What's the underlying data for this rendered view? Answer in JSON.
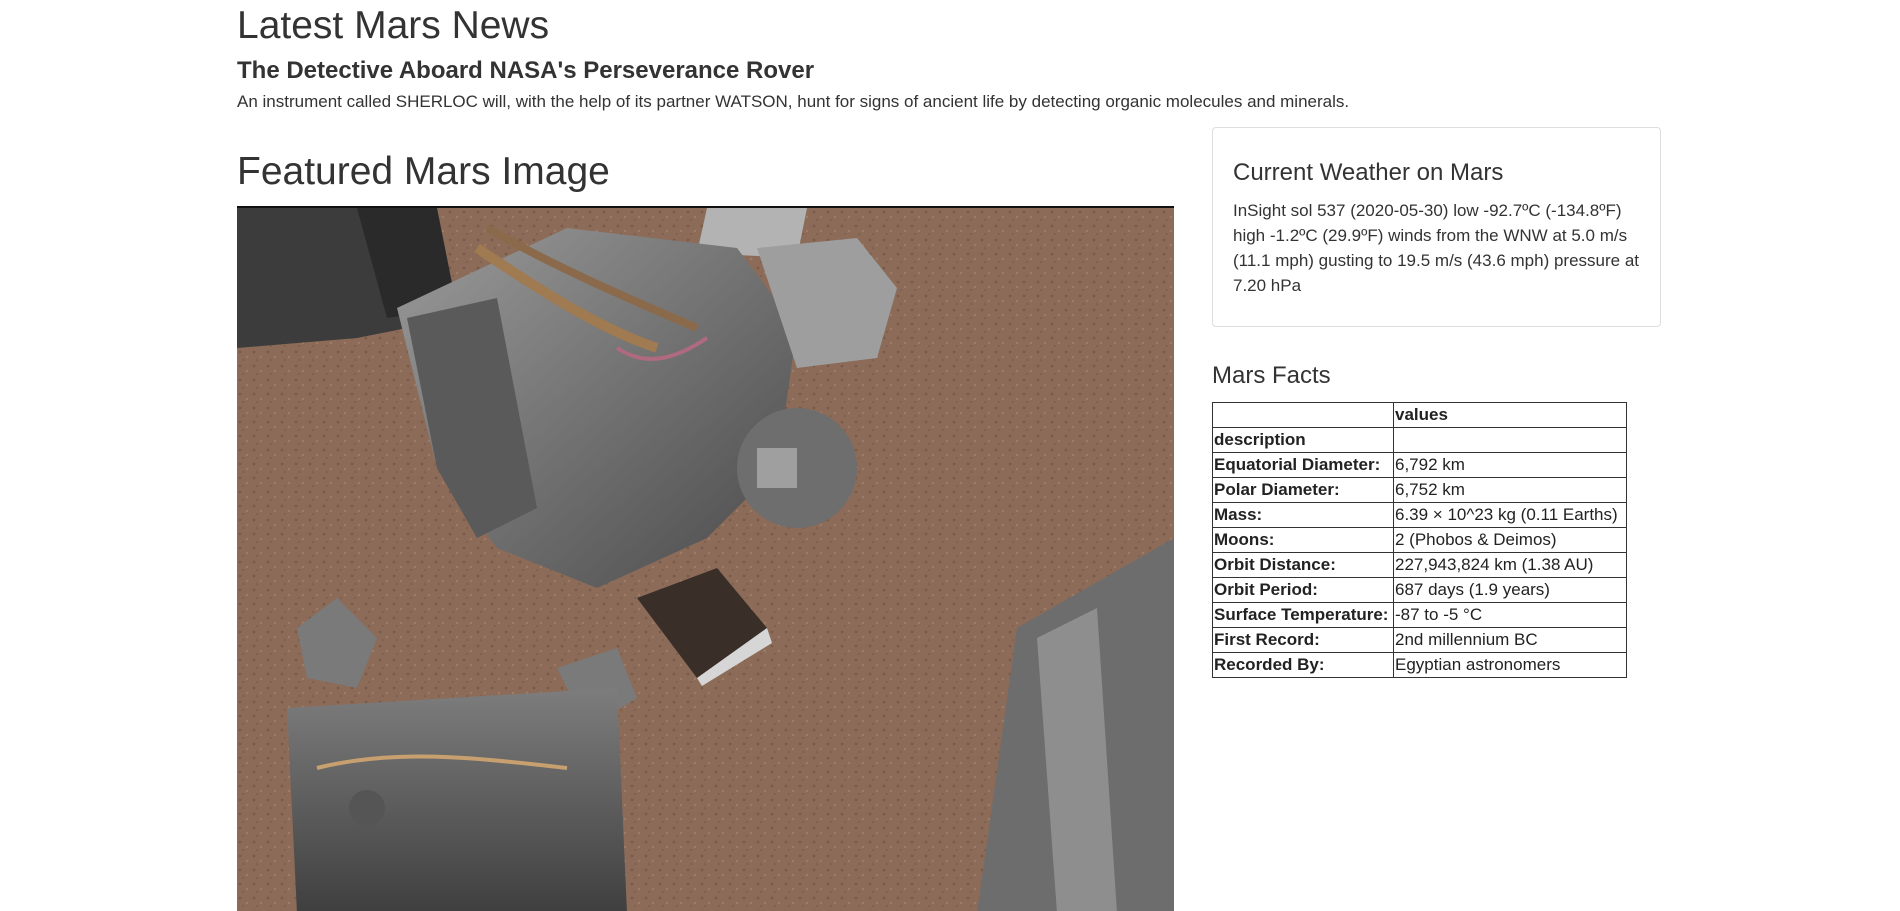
{
  "news": {
    "section_title": "Latest Mars News",
    "headline": "The Detective Aboard NASA's Perseverance Rover",
    "teaser": "An instrument called SHERLOC will, with the help of its partner WATSON, hunt for signs of ancient life by detecting organic molecules and minerals."
  },
  "featured": {
    "section_title": "Featured Mars Image"
  },
  "weather": {
    "title": "Current Weather on Mars",
    "text": "InSight sol 537 (2020-05-30) low -92.7ºC (-134.8ºF) high -1.2ºC (29.9ºF) winds from the WNW at 5.0 m/s (11.1 mph) gusting to 19.5 m/s (43.6 mph) pressure at 7.20 hPa"
  },
  "facts": {
    "title": "Mars Facts",
    "header_values": "values",
    "header_description": "description",
    "rows": [
      {
        "key": "Equatorial Diameter:",
        "value": "6,792 km"
      },
      {
        "key": "Polar Diameter:",
        "value": "6,752 km"
      },
      {
        "key": "Mass:",
        "value": "6.39 × 10^23 kg (0.11 Earths)"
      },
      {
        "key": "Moons:",
        "value": "2 (Phobos & Deimos)"
      },
      {
        "key": "Orbit Distance:",
        "value": "227,943,824 km (1.38 AU)"
      },
      {
        "key": "Orbit Period:",
        "value": "687 days (1.9 years)"
      },
      {
        "key": "Surface Temperature:",
        "value": "-87 to -5 °C"
      },
      {
        "key": "First Record:",
        "value": "2nd millennium BC"
      },
      {
        "key": "Recorded By:",
        "value": "Egyptian astronomers"
      }
    ]
  }
}
